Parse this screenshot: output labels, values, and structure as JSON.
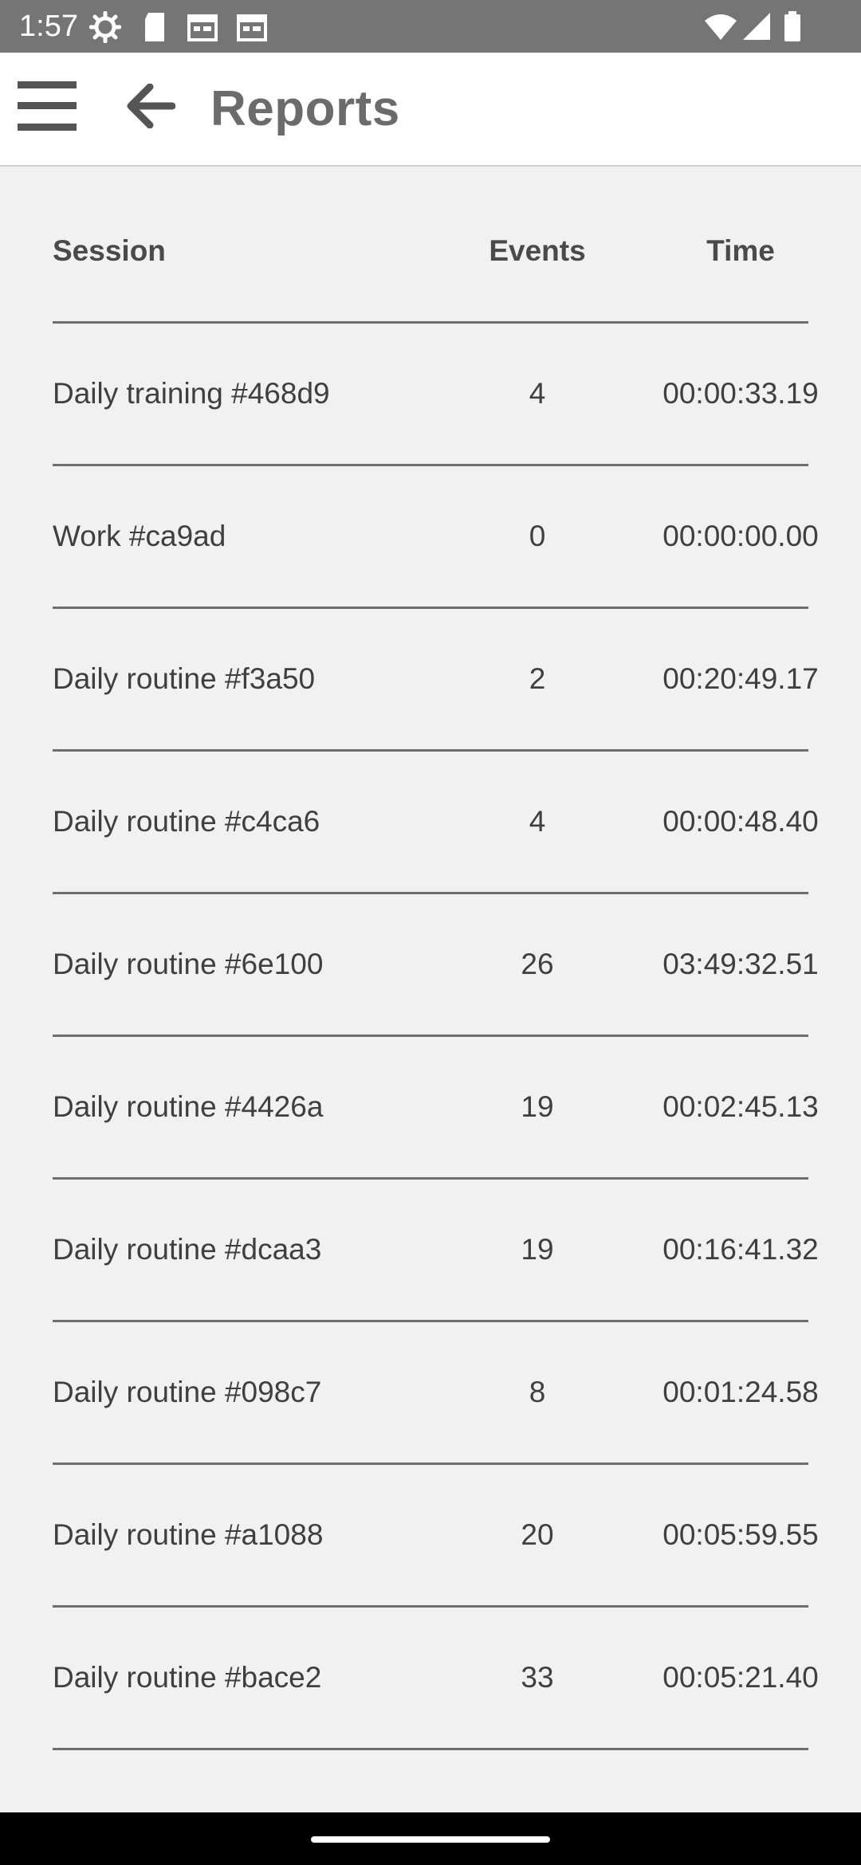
{
  "status_bar": {
    "time": "1:57",
    "icons_left": [
      "settings-icon",
      "sd-card-icon",
      "calendar-icon",
      "calendar-icon"
    ],
    "icons_right": [
      "wifi-icon",
      "signal-icon",
      "battery-icon"
    ]
  },
  "app_bar": {
    "title": "Reports",
    "menu_icon": "hamburger-menu-icon",
    "back_icon": "arrow-back-icon"
  },
  "table": {
    "headers": {
      "session": "Session",
      "events": "Events",
      "time": "Time"
    },
    "rows": [
      {
        "session": "Daily training #468d9",
        "events": "4",
        "time": "00:00:33.19"
      },
      {
        "session": "Work #ca9ad",
        "events": "0",
        "time": "00:00:00.00"
      },
      {
        "session": "Daily routine #f3a50",
        "events": "2",
        "time": "00:20:49.17"
      },
      {
        "session": "Daily routine #c4ca6",
        "events": "4",
        "time": "00:00:48.40"
      },
      {
        "session": "Daily routine #6e100",
        "events": "26",
        "time": "03:49:32.51"
      },
      {
        "session": "Daily routine #4426a",
        "events": "19",
        "time": "00:02:45.13"
      },
      {
        "session": "Daily routine #dcaa3",
        "events": "19",
        "time": "00:16:41.32"
      },
      {
        "session": "Daily routine #098c7",
        "events": "8",
        "time": "00:01:24.58"
      },
      {
        "session": "Daily routine #a1088",
        "events": "20",
        "time": "00:05:59.55"
      },
      {
        "session": "Daily routine #bace2",
        "events": "33",
        "time": "00:05:21.40"
      }
    ]
  },
  "colors": {
    "status_bar": "#757575",
    "background": "#f1f1f1",
    "app_bar": "#ffffff",
    "title": "#6b6b6b",
    "divider": "#6e6e6e"
  }
}
